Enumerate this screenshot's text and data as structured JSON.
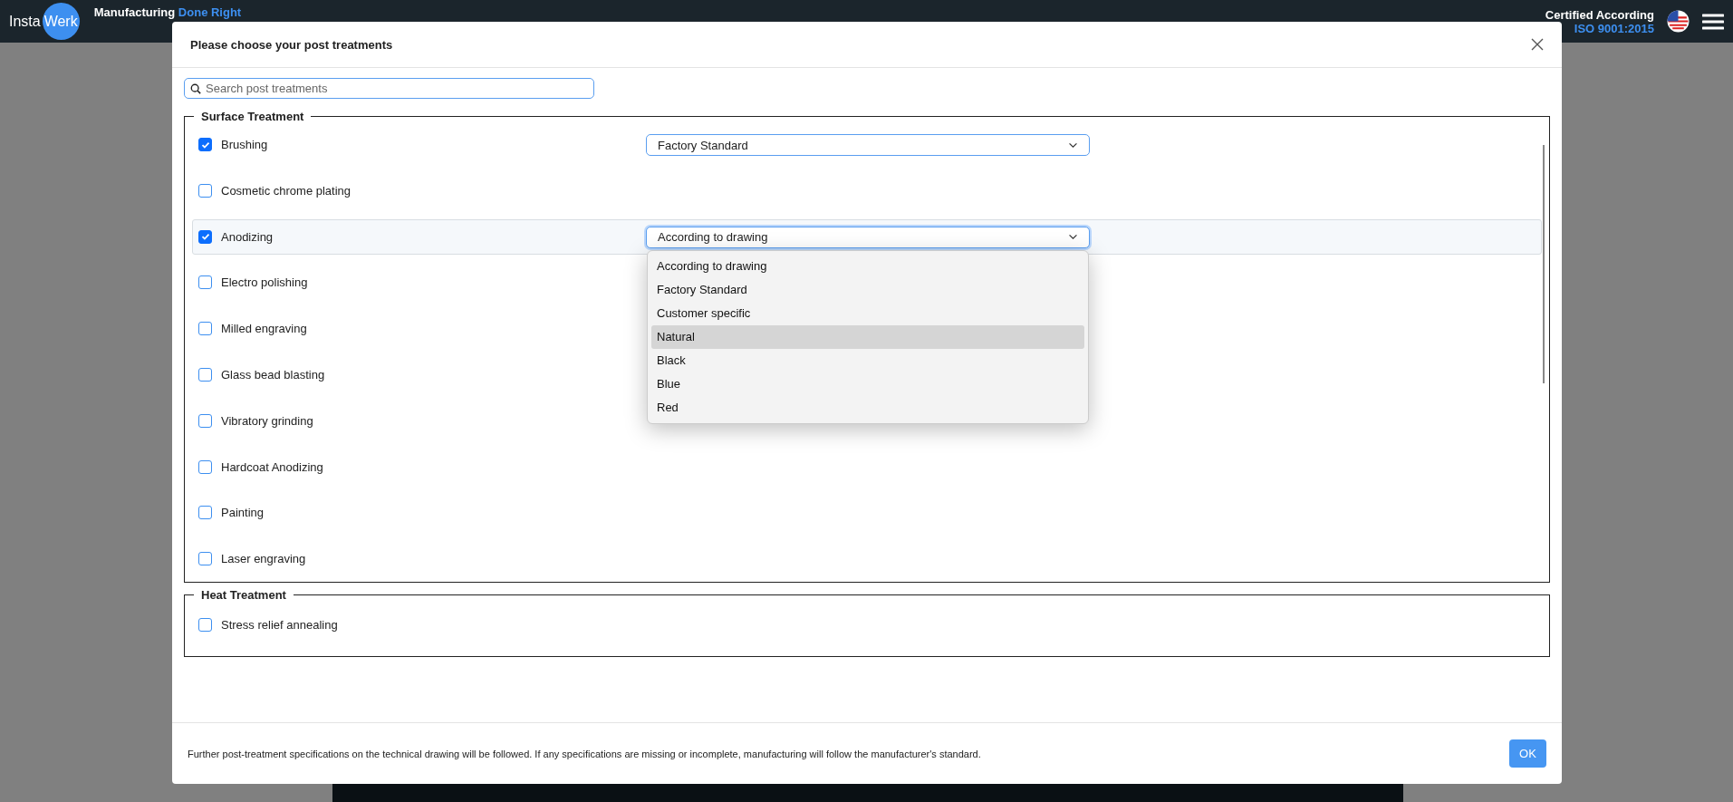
{
  "topbar": {
    "logo": [
      "Insta",
      "Werk"
    ],
    "tagline": "Manufacturing",
    "tagline_accent": "Done Right",
    "cert_line": "Certified According",
    "cert_accent": "ISO 9001:2015"
  },
  "dialog": {
    "title": "Please choose your post treatments",
    "search": {
      "placeholder": "Search post treatments"
    },
    "groups": [
      {
        "legend": "Surface Treatment",
        "scrollable": true,
        "items": [
          {
            "label": "Brushing",
            "checked": true,
            "active": false,
            "select": {
              "value": "Factory Standard",
              "open": false
            }
          },
          {
            "label": "Cosmetic chrome plating",
            "checked": false,
            "active": false
          },
          {
            "label": "Anodizing",
            "checked": true,
            "active": true,
            "select": {
              "value": "According to drawing",
              "open": true,
              "options": [
                {
                  "label": "According to drawing",
                  "highlighted": false
                },
                {
                  "label": "Factory Standard",
                  "highlighted": false
                },
                {
                  "label": "Customer specific",
                  "highlighted": false
                },
                {
                  "label": "Natural",
                  "highlighted": true
                },
                {
                  "label": "Black",
                  "highlighted": false
                },
                {
                  "label": "Blue",
                  "highlighted": false
                },
                {
                  "label": "Red",
                  "highlighted": false
                }
              ]
            }
          },
          {
            "label": "Electro polishing",
            "checked": false,
            "active": false
          },
          {
            "label": "Milled engraving",
            "checked": false,
            "active": false
          },
          {
            "label": "Glass bead blasting",
            "checked": false,
            "active": false
          },
          {
            "label": "Vibratory grinding",
            "checked": false,
            "active": false
          },
          {
            "label": "Hardcoat Anodizing",
            "checked": false,
            "active": false
          },
          {
            "label": "Painting",
            "checked": false,
            "active": false
          },
          {
            "label": "Laser engraving",
            "checked": false,
            "active": false
          }
        ]
      },
      {
        "legend": "Heat Treatment",
        "scrollable": false,
        "items": [
          {
            "label": "Stress relief annealing",
            "checked": false,
            "active": false
          }
        ]
      }
    ],
    "note": "Further post-treatment specifications on the technical drawing will be followed. If any specifications are missing or incomplete, manufacturing will follow the manufacturer's standard.",
    "ok_button": "OK"
  }
}
